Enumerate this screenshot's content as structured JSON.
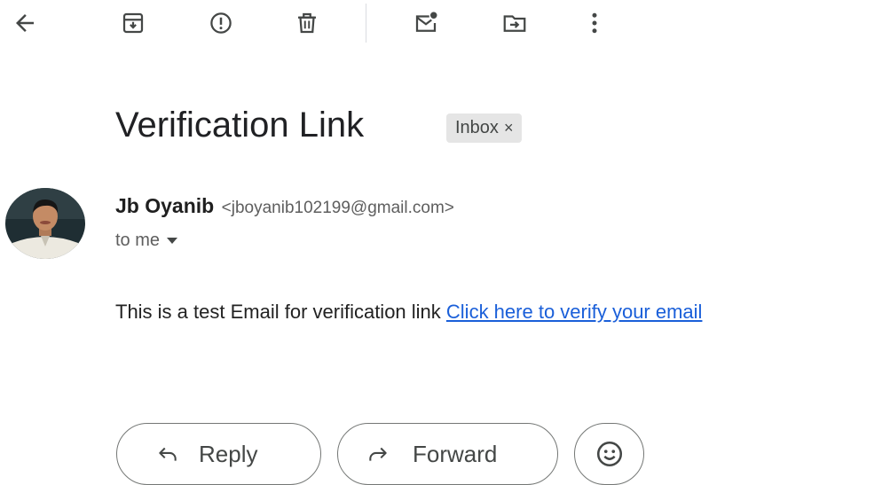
{
  "toolbar": {
    "back_icon": "arrow-left-icon",
    "archive_icon": "archive-icon",
    "spam_icon": "report-spam-icon",
    "delete_icon": "trash-icon",
    "unread_icon": "mark-unread-icon",
    "move_icon": "move-to-folder-icon",
    "more_icon": "more-vertical-icon"
  },
  "email": {
    "subject": "Verification Link",
    "label": "Inbox",
    "label_remove": "×",
    "sender_name": "Jb Oyanib",
    "sender_email": "<jboyanib102199@gmail.com>",
    "recipient": "to me",
    "body_text": "This is a test Email for verification link",
    "link_text": "Click here to verify your email"
  },
  "actions": {
    "reply_label": "Reply",
    "forward_label": "Forward",
    "emoji_icon": "smiley-icon"
  },
  "colors": {
    "link": "#1a5fd9",
    "chip_bg": "#e5e5e5",
    "text": "#202124"
  }
}
